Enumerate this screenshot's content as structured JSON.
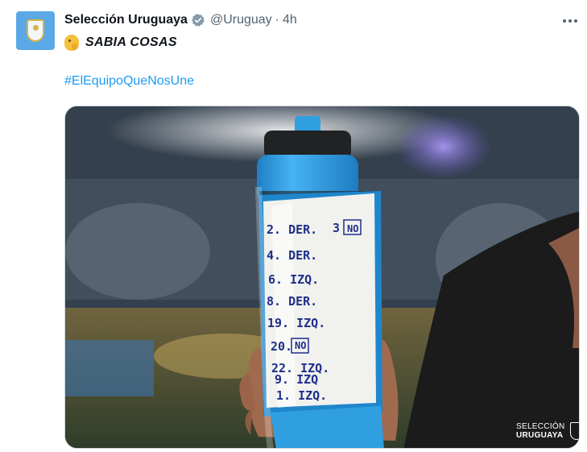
{
  "tweet": {
    "display_name": "Selección Uruguaya",
    "handle": "@Uruguay",
    "separator": "·",
    "time": "4h",
    "text": "SABIA COSAS",
    "hashtag": "#ElEquipoQueNosUne"
  },
  "bottle_notes": [
    "2. DER.",
    "3",
    "NO",
    "4. DER.",
    "6. IZQ.",
    "8. DER.",
    "19. IZQ.",
    "20.",
    "NO",
    "22. IZQ.",
    "9. IZQ",
    "1. IZQ."
  ],
  "watermark": {
    "line1": "SELECCIÓN",
    "line2": "URUGUAYA"
  },
  "icons": {
    "verified": "verified-badge-icon",
    "more": "more-options-icon",
    "emoji": "shushing-face-emoji-icon"
  },
  "colors": {
    "link": "#1d9bf0",
    "secondary": "#536471",
    "bottle_blue": "#2f9fe0"
  }
}
